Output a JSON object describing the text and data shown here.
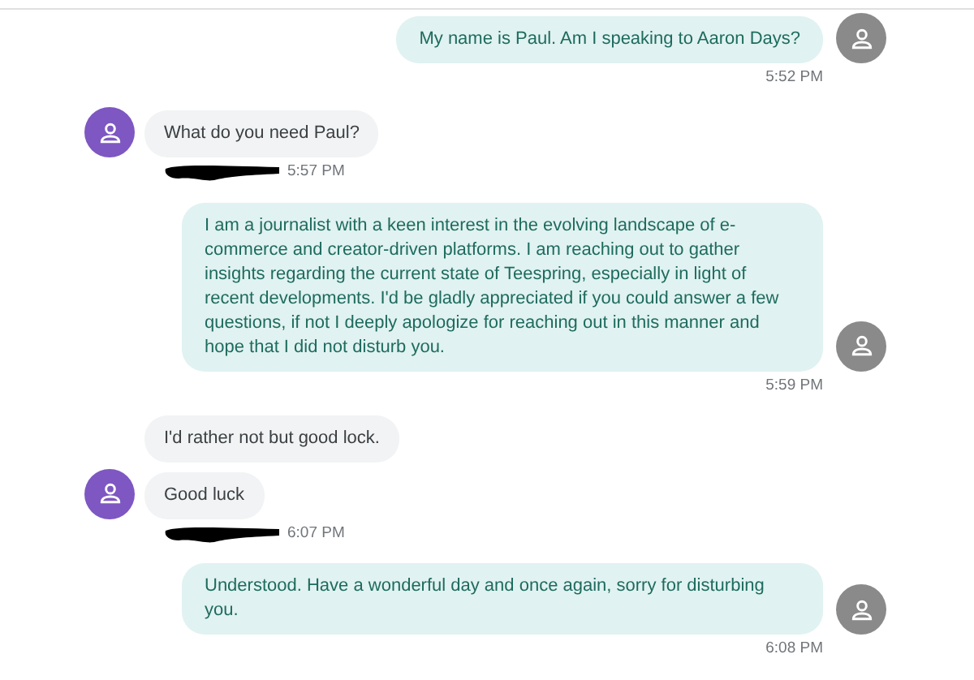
{
  "messages": [
    {
      "kind": "outgoing",
      "text": "My name is Paul. Am I speaking to Aaron Days?",
      "avatar": true,
      "time": "5:52 PM",
      "redacted_sender": false
    },
    {
      "kind": "incoming",
      "text": "What do you need Paul?",
      "avatar": true,
      "time": "5:57 PM",
      "redacted_sender": true
    },
    {
      "kind": "outgoing",
      "text": "I am a journalist with a keen interest in the evolving landscape of e-commerce and creator-driven platforms. I am reaching out to gather insights regarding the current state of Teespring, especially in light of recent developments. I'd be gladly appreciated if you could answer a few questions, if not I deeply apologize for reaching out in this manner and hope that I did not disturb you.",
      "avatar": true,
      "time": "5:59 PM",
      "redacted_sender": false
    },
    {
      "kind": "incoming",
      "text": "I'd rather not but good lock.",
      "avatar": false,
      "redacted_sender": false
    },
    {
      "kind": "incoming",
      "text": "Good luck",
      "avatar": true,
      "time": "6:07 PM",
      "redacted_sender": true
    },
    {
      "kind": "outgoing",
      "text": "Understood. Have a wonderful day and once again, sorry for disturbing you.",
      "avatar": true,
      "time": "6:08 PM",
      "redacted_sender": false
    }
  ]
}
